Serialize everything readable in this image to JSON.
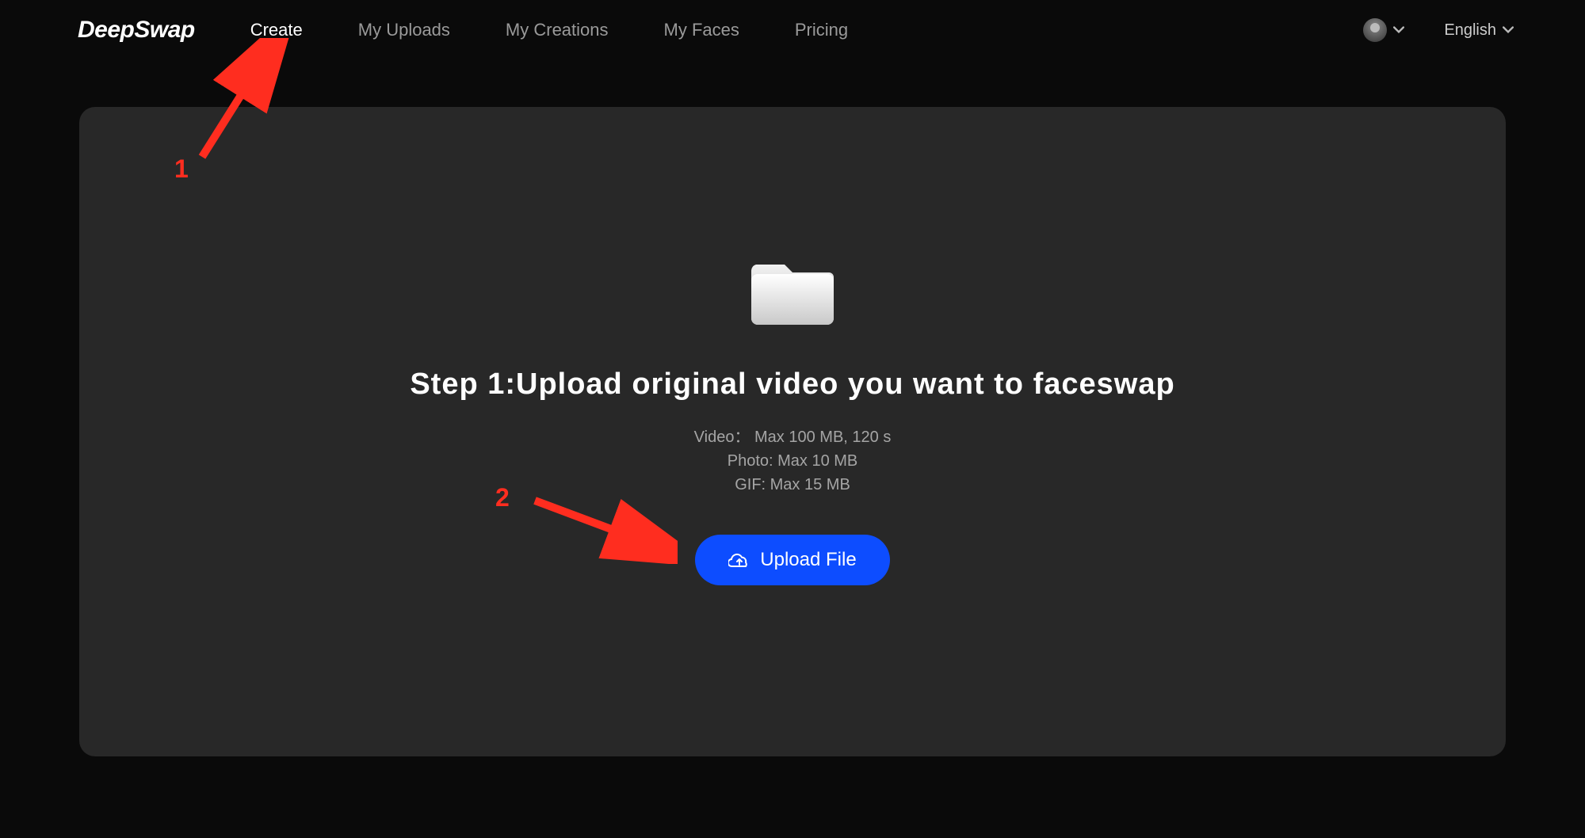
{
  "brand": "DeepSwap",
  "nav": {
    "items": [
      {
        "label": "Create",
        "active": true
      },
      {
        "label": "My Uploads",
        "active": false
      },
      {
        "label": "My Creations",
        "active": false
      },
      {
        "label": "My Faces",
        "active": false
      },
      {
        "label": "Pricing",
        "active": false
      }
    ]
  },
  "header": {
    "language": "English"
  },
  "panel": {
    "heading": "Step 1:Upload original video you want to faceswap",
    "limits": {
      "video": "Video： Max 100 MB, 120 s",
      "photo": "Photo: Max 10 MB",
      "gif": "GIF: Max 15 MB"
    },
    "upload_label": "Upload File"
  },
  "annotations": {
    "one": "1",
    "two": "2"
  },
  "colors": {
    "accent": "#0d4dff",
    "annotation": "#ff2d1f",
    "panel_bg": "#282828",
    "page_bg": "#0a0a0a"
  }
}
